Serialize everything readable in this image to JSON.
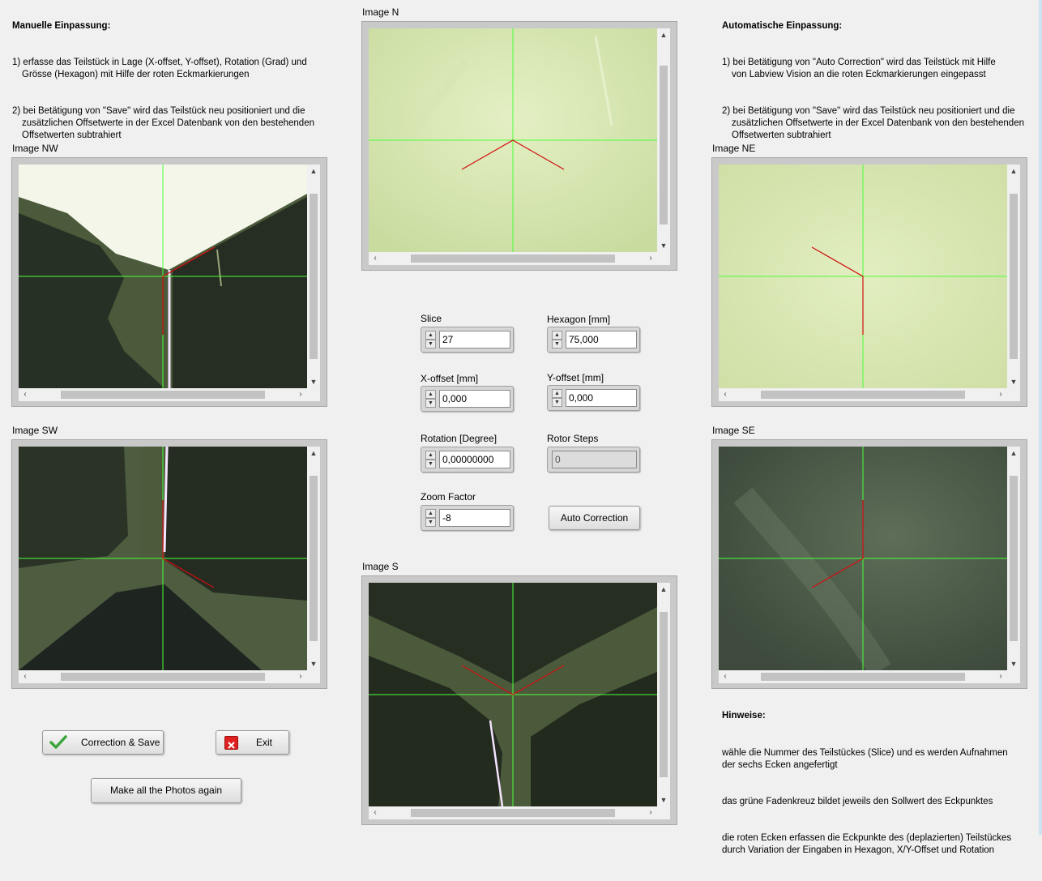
{
  "manual": {
    "heading": "Manuelle Einpassung:",
    "items": [
      "1) erfasse das Teilstück in Lage (X-offset, Y-offset), Rotation (Grad) und\nGrösse (Hexagon) mit Hilfe der roten Eckmarkierungen",
      "2) bei Betätigung von \"Save\" wird das Teilstück neu positioniert und die\nzusätzlichen Offsetwerte in der Excel Datenbank von den bestehenden\nOffsetwerten subtrahiert"
    ]
  },
  "auto": {
    "heading": "Automatische Einpassung:",
    "items": [
      "1) bei Betätigung von \"Auto Correction\" wird das Teilstück mit Hilfe\nvon Labview Vision an die roten Eckmarkierungen eingepasst",
      "2) bei Betätigung von \"Save\" wird das Teilstück neu positioniert und die\nzusätzlichen Offsetwerte in der Excel Datenbank von den bestehenden\nOffsetwerten subtrahiert"
    ]
  },
  "images": {
    "n": "Image N",
    "nw": "Image NW",
    "ne": "Image NE",
    "sw": "Image SW",
    "se": "Image SE",
    "s": "Image S"
  },
  "controls": {
    "slice": {
      "label": "Slice",
      "value": "27"
    },
    "hexagon": {
      "label": "Hexagon [mm]",
      "value": "75,000"
    },
    "xoffset": {
      "label": "X-offset [mm]",
      "value": "0,000"
    },
    "yoffset": {
      "label": "Y-offset [mm]",
      "value": "0,000"
    },
    "rotation": {
      "label": "Rotation [Degree]",
      "value": "0,00000000"
    },
    "rotor": {
      "label": "Rotor Steps",
      "value": "0"
    },
    "zoom": {
      "label": "Zoom Factor",
      "value": "-8"
    }
  },
  "buttons": {
    "auto_correction": "Auto Correction",
    "correction_save": "Correction & Save",
    "exit": "Exit",
    "make_photos": "Make all the Photos again"
  },
  "hints": {
    "heading": "Hinweise:",
    "items": [
      "wähle die Nummer des  Teilstückes (Slice) und es werden Aufnahmen\nder sechs Ecken angefertigt",
      "das grüne Fadenkreuz bildet jeweils den Sollwert des Eckpunktes",
      "die roten Ecken erfassen die Eckpunkte des (deplazierten) Teilstückes\ndurch Variation der Eingaben in Hexagon, X/Y-Offset und Rotation"
    ]
  },
  "colors": {
    "crosshair": "#4cff3a",
    "marker": "#d01010",
    "exit_icon": "#e02020",
    "check_icon": "#3aa63a"
  }
}
